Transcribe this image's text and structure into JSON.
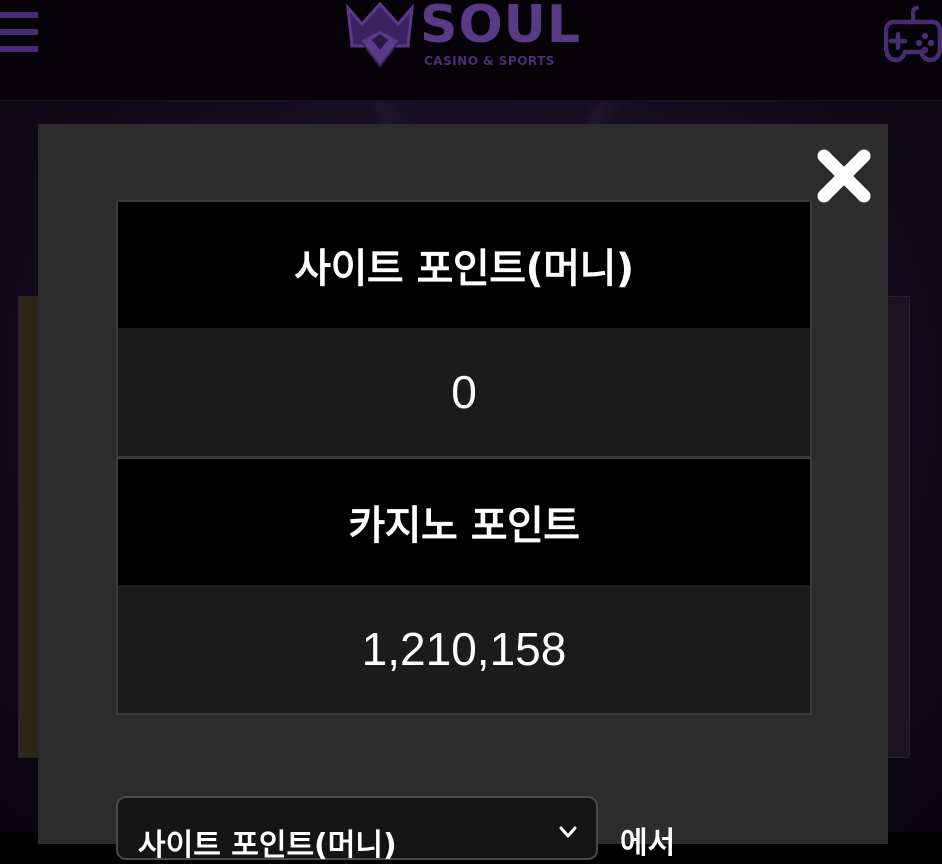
{
  "header": {
    "menu_icon": "hamburger-menu-icon",
    "logo_text": "SOUL",
    "logo_subtitle": "CASINO & SPORTS",
    "logo_icon": "crown-diamond-icon",
    "game_icon": "gamepad-icon"
  },
  "modal": {
    "close_icon": "close-icon",
    "site_points": {
      "label": "사이트 포인트(머니)",
      "value": "0"
    },
    "casino_points": {
      "label": "카지노 포인트",
      "value": "1,210,158"
    },
    "convert": {
      "selected": "사이트 포인트(머니)",
      "suffix": "에서"
    }
  },
  "colors": {
    "brand_purple": "#5a3a86",
    "modal_bg": "#2c2c2c",
    "value_bg": "#1b1b1b"
  }
}
